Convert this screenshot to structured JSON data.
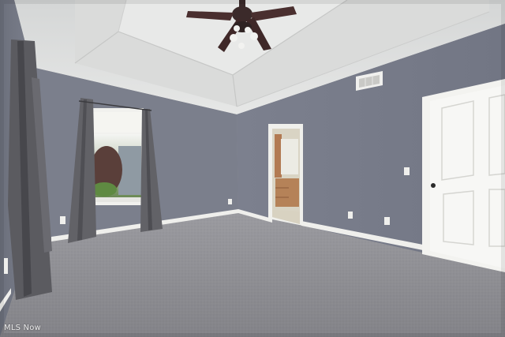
{
  "photo": {
    "watermark_text": "MLS Now",
    "colors": {
      "wall": "#7a7e8c",
      "wall_dark": "#6a6e7b",
      "ceiling": "#e2e3e2",
      "carpet": "#8e8e92",
      "trim": "#f2f2ef",
      "curtain": "#5e5e63",
      "fan": "#3b2a2a"
    }
  }
}
